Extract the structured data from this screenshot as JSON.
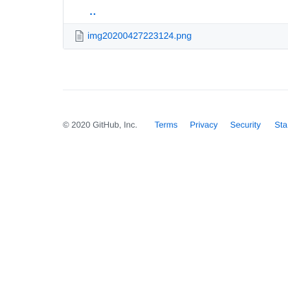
{
  "file_list": {
    "parent_dir_label": "..",
    "files": [
      {
        "name": "img20200427223124.png",
        "icon": "file-icon"
      }
    ]
  },
  "footer": {
    "copyright": "© 2020 GitHub, Inc.",
    "links": [
      "Terms",
      "Privacy",
      "Security",
      "Sta"
    ]
  },
  "colors": {
    "link": "#0366d6",
    "muted_text": "#586069",
    "border": "#e1e4e8"
  }
}
